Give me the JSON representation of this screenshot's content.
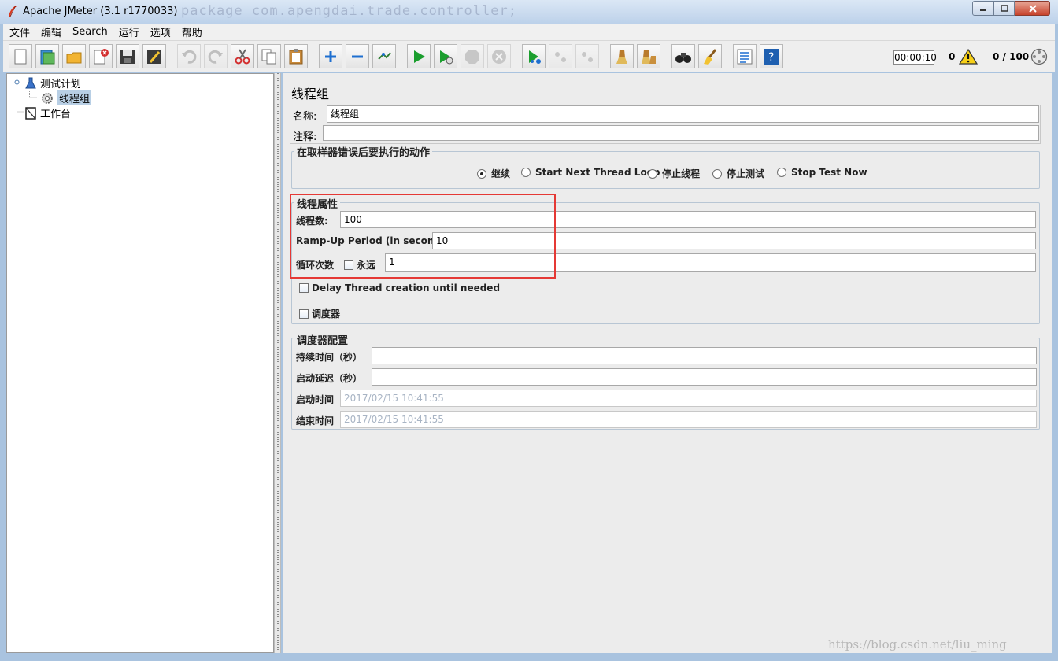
{
  "window": {
    "title": "Apache JMeter (3.1 r1770033)",
    "background_code": "package com.apengdai.trade.controller;"
  },
  "menu": [
    "文件",
    "编辑",
    "Search",
    "运行",
    "选项",
    "帮助"
  ],
  "toolbar": {
    "buttons": [
      "new-icon",
      "templates-icon",
      "open-icon",
      "close-icon",
      "save-icon",
      "save-as-icon",
      "undo-icon",
      "redo-icon",
      "cut-icon",
      "copy-icon",
      "paste-icon",
      "expand-icon",
      "collapse-icon",
      "toggle-icon",
      "start-icon",
      "start-no-pause-icon",
      "stop-icon",
      "shutdown-icon",
      "remote-start-icon",
      "remote-stop-icon",
      "remote-shutdown-icon",
      "clear-icon",
      "clear-all-icon",
      "search-icon",
      "reset-search-icon",
      "function-helper-icon",
      "help-icon"
    ],
    "elapsed": "00:00:10",
    "error_count": "0",
    "threads": "0 / 100"
  },
  "tree": {
    "test_plan": "测试计划",
    "thread_group": "线程组",
    "workbench": "工作台"
  },
  "panel": {
    "title": "线程组",
    "name_label": "名称:",
    "name_value": "线程组",
    "comment_label": "注释:",
    "comment_value": "",
    "on_error": {
      "title": "在取样器错误后要执行的动作",
      "options": [
        "继续",
        "Start Next Thread Loop",
        "停止线程",
        "停止测试",
        "Stop Test Now"
      ],
      "selected": "继续"
    },
    "thread_props": {
      "title": "线程属性",
      "threads_label": "线程数:",
      "threads_value": "100",
      "rampup_label": "Ramp-Up Period (in seconds):",
      "rampup_value": "10",
      "loop_label": "循环次数",
      "forever_label": "永远",
      "loop_value": "1",
      "delay_label": "Delay Thread creation until needed",
      "scheduler_label": "调度器"
    },
    "scheduler_config": {
      "title": "调度器配置",
      "duration_label": "持续时间（秒）",
      "duration_value": "",
      "startup_delay_label": "启动延迟（秒）",
      "startup_delay_value": "",
      "start_time_label": "启动时间",
      "start_time_value": "2017/02/15 10:41:55",
      "end_time_label": "结束时间",
      "end_time_value": "2017/02/15 10:41:55"
    }
  },
  "watermark": "https://blog.csdn.net/liu_ming"
}
